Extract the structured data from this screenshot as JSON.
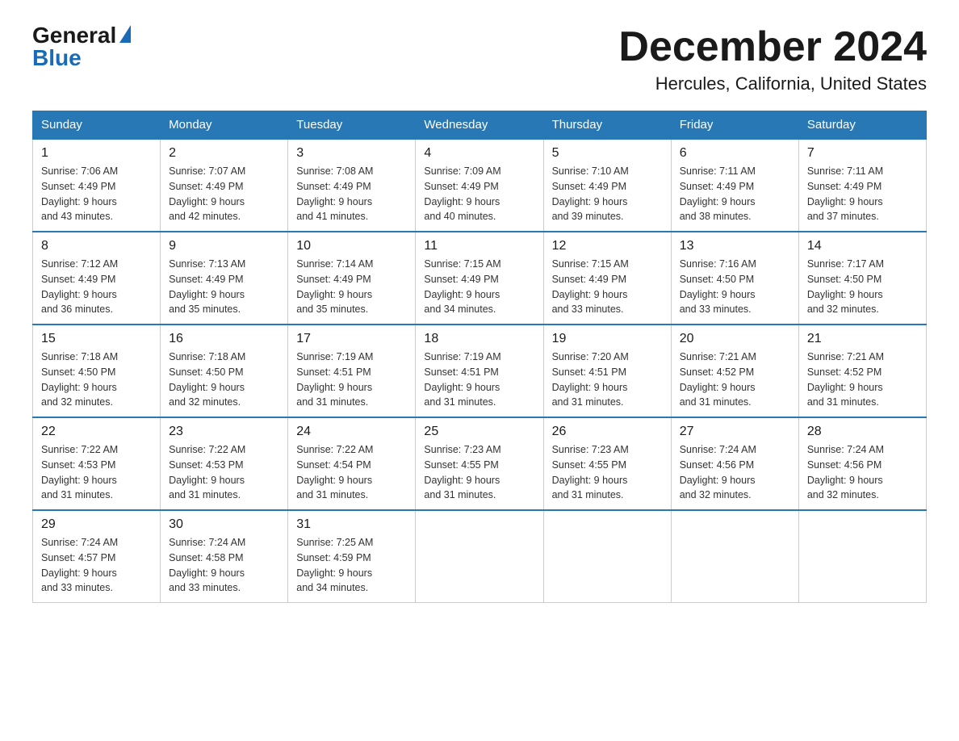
{
  "header": {
    "logo_general": "General",
    "logo_blue": "Blue",
    "month_title": "December 2024",
    "location": "Hercules, California, United States"
  },
  "weekdays": [
    "Sunday",
    "Monday",
    "Tuesday",
    "Wednesday",
    "Thursday",
    "Friday",
    "Saturday"
  ],
  "weeks": [
    [
      {
        "day": "1",
        "sunrise": "7:06 AM",
        "sunset": "4:49 PM",
        "daylight": "9 hours and 43 minutes."
      },
      {
        "day": "2",
        "sunrise": "7:07 AM",
        "sunset": "4:49 PM",
        "daylight": "9 hours and 42 minutes."
      },
      {
        "day": "3",
        "sunrise": "7:08 AM",
        "sunset": "4:49 PM",
        "daylight": "9 hours and 41 minutes."
      },
      {
        "day": "4",
        "sunrise": "7:09 AM",
        "sunset": "4:49 PM",
        "daylight": "9 hours and 40 minutes."
      },
      {
        "day": "5",
        "sunrise": "7:10 AM",
        "sunset": "4:49 PM",
        "daylight": "9 hours and 39 minutes."
      },
      {
        "day": "6",
        "sunrise": "7:11 AM",
        "sunset": "4:49 PM",
        "daylight": "9 hours and 38 minutes."
      },
      {
        "day": "7",
        "sunrise": "7:11 AM",
        "sunset": "4:49 PM",
        "daylight": "9 hours and 37 minutes."
      }
    ],
    [
      {
        "day": "8",
        "sunrise": "7:12 AM",
        "sunset": "4:49 PM",
        "daylight": "9 hours and 36 minutes."
      },
      {
        "day": "9",
        "sunrise": "7:13 AM",
        "sunset": "4:49 PM",
        "daylight": "9 hours and 35 minutes."
      },
      {
        "day": "10",
        "sunrise": "7:14 AM",
        "sunset": "4:49 PM",
        "daylight": "9 hours and 35 minutes."
      },
      {
        "day": "11",
        "sunrise": "7:15 AM",
        "sunset": "4:49 PM",
        "daylight": "9 hours and 34 minutes."
      },
      {
        "day": "12",
        "sunrise": "7:15 AM",
        "sunset": "4:49 PM",
        "daylight": "9 hours and 33 minutes."
      },
      {
        "day": "13",
        "sunrise": "7:16 AM",
        "sunset": "4:50 PM",
        "daylight": "9 hours and 33 minutes."
      },
      {
        "day": "14",
        "sunrise": "7:17 AM",
        "sunset": "4:50 PM",
        "daylight": "9 hours and 32 minutes."
      }
    ],
    [
      {
        "day": "15",
        "sunrise": "7:18 AM",
        "sunset": "4:50 PM",
        "daylight": "9 hours and 32 minutes."
      },
      {
        "day": "16",
        "sunrise": "7:18 AM",
        "sunset": "4:50 PM",
        "daylight": "9 hours and 32 minutes."
      },
      {
        "day": "17",
        "sunrise": "7:19 AM",
        "sunset": "4:51 PM",
        "daylight": "9 hours and 31 minutes."
      },
      {
        "day": "18",
        "sunrise": "7:19 AM",
        "sunset": "4:51 PM",
        "daylight": "9 hours and 31 minutes."
      },
      {
        "day": "19",
        "sunrise": "7:20 AM",
        "sunset": "4:51 PM",
        "daylight": "9 hours and 31 minutes."
      },
      {
        "day": "20",
        "sunrise": "7:21 AM",
        "sunset": "4:52 PM",
        "daylight": "9 hours and 31 minutes."
      },
      {
        "day": "21",
        "sunrise": "7:21 AM",
        "sunset": "4:52 PM",
        "daylight": "9 hours and 31 minutes."
      }
    ],
    [
      {
        "day": "22",
        "sunrise": "7:22 AM",
        "sunset": "4:53 PM",
        "daylight": "9 hours and 31 minutes."
      },
      {
        "day": "23",
        "sunrise": "7:22 AM",
        "sunset": "4:53 PM",
        "daylight": "9 hours and 31 minutes."
      },
      {
        "day": "24",
        "sunrise": "7:22 AM",
        "sunset": "4:54 PM",
        "daylight": "9 hours and 31 minutes."
      },
      {
        "day": "25",
        "sunrise": "7:23 AM",
        "sunset": "4:55 PM",
        "daylight": "9 hours and 31 minutes."
      },
      {
        "day": "26",
        "sunrise": "7:23 AM",
        "sunset": "4:55 PM",
        "daylight": "9 hours and 31 minutes."
      },
      {
        "day": "27",
        "sunrise": "7:24 AM",
        "sunset": "4:56 PM",
        "daylight": "9 hours and 32 minutes."
      },
      {
        "day": "28",
        "sunrise": "7:24 AM",
        "sunset": "4:56 PM",
        "daylight": "9 hours and 32 minutes."
      }
    ],
    [
      {
        "day": "29",
        "sunrise": "7:24 AM",
        "sunset": "4:57 PM",
        "daylight": "9 hours and 33 minutes."
      },
      {
        "day": "30",
        "sunrise": "7:24 AM",
        "sunset": "4:58 PM",
        "daylight": "9 hours and 33 minutes."
      },
      {
        "day": "31",
        "sunrise": "7:25 AM",
        "sunset": "4:59 PM",
        "daylight": "9 hours and 34 minutes."
      },
      null,
      null,
      null,
      null
    ]
  ],
  "labels": {
    "sunrise": "Sunrise:",
    "sunset": "Sunset:",
    "daylight": "Daylight:"
  }
}
